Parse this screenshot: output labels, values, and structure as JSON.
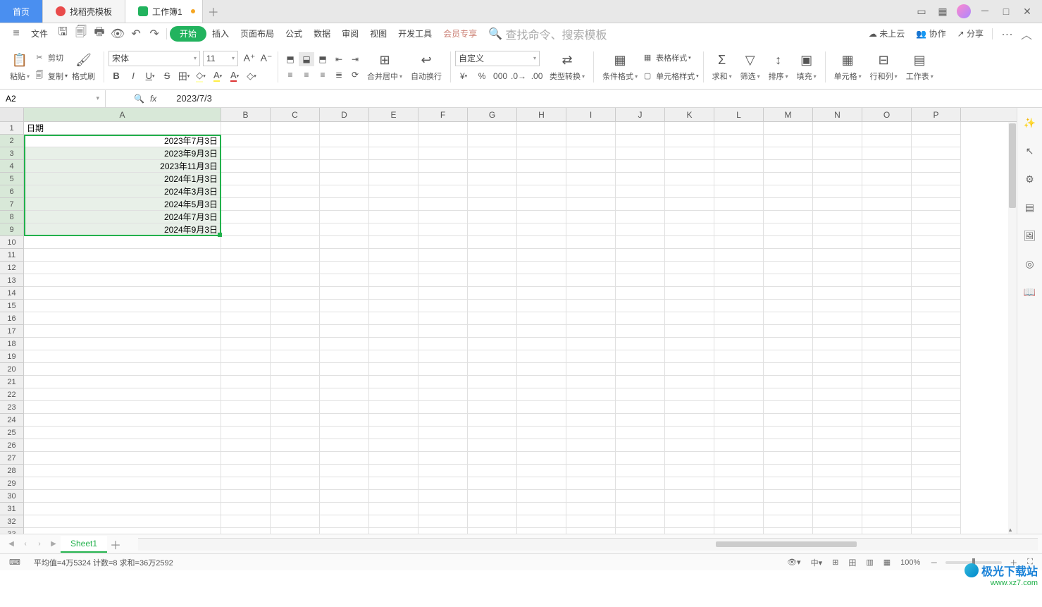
{
  "tabs": {
    "home": "首页",
    "templates": "找稻壳模板",
    "workbook": "工作簿1"
  },
  "menu": {
    "file": "文件",
    "start": "开始",
    "insert": "插入",
    "pagelayout": "页面布局",
    "formula": "公式",
    "data": "数据",
    "review": "审阅",
    "view": "视图",
    "devtools": "开发工具",
    "member": "会员专享",
    "search_ph": "查找命令、搜索模板",
    "nocloud": "未上云",
    "collab": "协作",
    "share": "分享"
  },
  "toolbar": {
    "paste": "粘贴",
    "cut": "剪切",
    "copy": "复制",
    "fmtpaint": "格式刷",
    "font": "宋体",
    "size": "11",
    "mergecenter": "合并居中",
    "autowrap": "自动换行",
    "numfmt": "自定义",
    "typeconv": "类型转换",
    "condfmt": "条件格式",
    "tablefmt": "表格样式",
    "cellfmt": "单元格样式",
    "sum": "求和",
    "filter": "筛选",
    "sort": "排序",
    "fill": "填充",
    "cells": "单元格",
    "rowcol": "行和列",
    "worksheet": "工作表"
  },
  "fbar": {
    "namebox": "A2",
    "formula": "2023/7/3"
  },
  "columns": [
    "A",
    "B",
    "C",
    "D",
    "E",
    "F",
    "G",
    "H",
    "I",
    "J",
    "K",
    "L",
    "M",
    "N",
    "O",
    "P"
  ],
  "sheet": {
    "header": "日期",
    "data": [
      "2023年7月3日",
      "2023年9月3日",
      "2023年11月3日",
      "2024年1月3日",
      "2024年3月3日",
      "2024年5月3日",
      "2024年7月3日",
      "2024年9月3日"
    ],
    "name": "Sheet1"
  },
  "status": {
    "stats": "平均值=4万5324  计数=8  求和=36万2592",
    "zoom": "100%"
  },
  "watermark": {
    "brand": "极光下载站",
    "url": "www.xz7.com"
  },
  "colors": {
    "accent": "#22b14c",
    "tabblue": "#4a8ff0"
  }
}
